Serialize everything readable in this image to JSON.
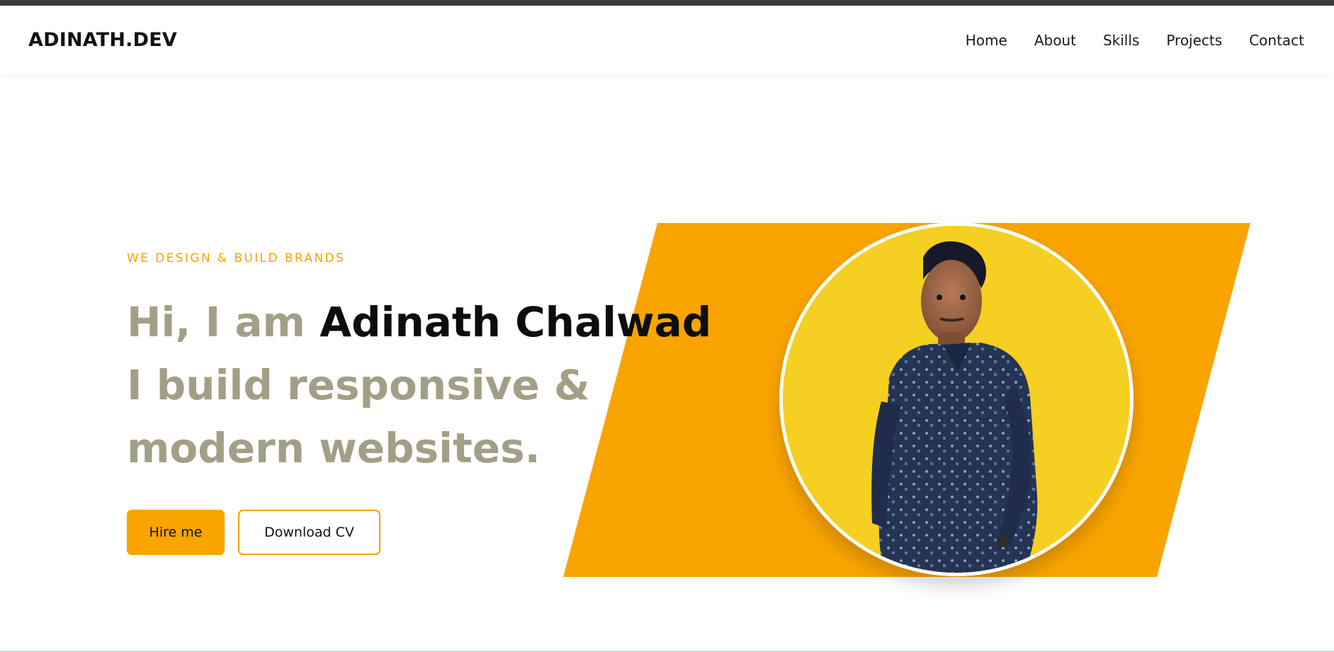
{
  "brand": {
    "logo": "ADINATH.DEV"
  },
  "nav": {
    "items": [
      "Home",
      "About",
      "Skills",
      "Projects",
      "Contact"
    ]
  },
  "hero": {
    "tagline": "WE DESIGN & BUILD BRANDS",
    "greeting": "Hi, I am ",
    "name": "Adinath Chalwad",
    "line2": "I build responsive &",
    "line3": "modern websites.",
    "primary_button": "Hire me",
    "secondary_button": "Download CV"
  },
  "colors": {
    "accent": "#f9a400",
    "headline_muted": "#a39f87",
    "photo_background": "#f5cf22"
  }
}
